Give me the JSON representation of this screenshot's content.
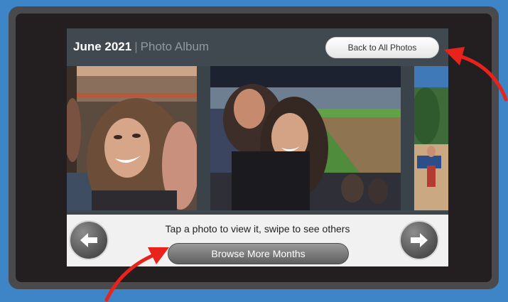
{
  "album": {
    "month": "June 2021",
    "separator": "|",
    "name": "Photo Album"
  },
  "header": {
    "back_label": "Back to All Photos"
  },
  "footer": {
    "hint": "Tap a photo to view it, swipe to see others",
    "browse_label": "Browse More Months"
  },
  "icons": {
    "previous": "arrow-left-icon",
    "next": "arrow-right-icon",
    "annotation": "red-curved-arrow"
  },
  "colors": {
    "background": "#3d85c6",
    "device_frame": "#4a4a4c",
    "screen_header": "#414950",
    "annotation_arrow": "#e8231b"
  }
}
